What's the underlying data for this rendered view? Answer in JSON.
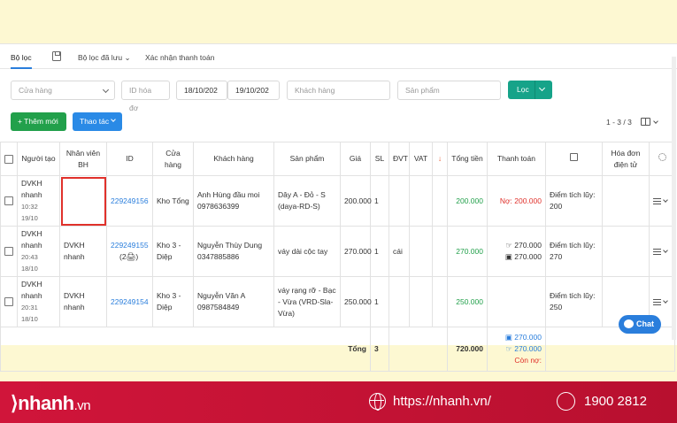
{
  "tabs": {
    "filter": "Bộ lọc",
    "saved": "Bộ lọc đã lưu",
    "confirm": "Xác nhận thanh toán"
  },
  "filters": {
    "store_placeholder": "Cửa hàng",
    "invoice_id_placeholder": "ID hóa đơ",
    "date_from": "18/10/202",
    "date_to": "19/10/202",
    "customer_placeholder": "Khách hàng",
    "product_placeholder": "Sản phẩm",
    "filter_button": "Lọc"
  },
  "toolbar": {
    "add_button": "+ Thêm mới",
    "actions_button": "Thao tác",
    "pagination": "1 - 3 / 3"
  },
  "table": {
    "headers": {
      "creator": "Người tạo",
      "sales_staff": "Nhân viên BH",
      "id": "ID",
      "store": "Cửa hàng",
      "customer": "Khách hàng",
      "product": "Sản phẩm",
      "price": "Giá",
      "qty": "SL",
      "unit": "ĐVT",
      "vat": "VAT",
      "sort_arrow": "↓",
      "total": "Tổng tiền",
      "payment": "Thanh toán",
      "invoice": "Hóa đơn điện tử"
    },
    "rows": [
      {
        "creator": "DVKH nhanh",
        "time": "10:32 19/10",
        "staff": "",
        "id": "229249156",
        "store": "Kho Tổng",
        "customer_name": "Anh Hùng đầu moi",
        "customer_phone": "0978636399",
        "product": "Dây A - Đỏ - S (daya-RD-S)",
        "price": "200.000",
        "qty": "1",
        "unit": "",
        "total": "200.000",
        "payment_1": "Nợ: 200.000",
        "payment_2": "",
        "points": "Điểm tích lũy: 200"
      },
      {
        "creator": "DVKH nhanh",
        "time": "20:43 18/10",
        "staff": "DVKH nhanh",
        "id": "229249155",
        "id_extra": "(2🖨)",
        "store": "Kho 3 - Diệp",
        "customer_name": "Nguyễn Thùy Dung",
        "customer_phone": "0347885886",
        "product": "váy dài cộc tay",
        "price": "270.000",
        "qty": "1",
        "unit": "cái",
        "total": "270.000",
        "payment_1": "270.000",
        "payment_2": "270.000",
        "points": "Điểm tích lũy: 270"
      },
      {
        "creator": "DVKH nhanh",
        "time": "20:31 18/10",
        "staff": "DVKH nhanh",
        "id": "229249154",
        "store": "Kho 3 - Diệp",
        "customer_name": "Nguyễn Văn A",
        "customer_phone": "0987584849",
        "product": "váy rạng rỡ - Bạc - Vừa (VRD-Sla-Vừa)",
        "price": "250.000",
        "qty": "1",
        "unit": "",
        "total": "250.000",
        "payment_1": "",
        "payment_2": "",
        "points": "Điểm tích lũy: 250"
      }
    ],
    "summary": {
      "label": "Tổng",
      "qty": "3",
      "total": "720.000",
      "pay_1": "270.000",
      "pay_2": "270.000",
      "debt": "Còn nợ:"
    }
  },
  "chat": {
    "label": "Chat"
  },
  "footer": {
    "logo": "nhanh",
    "logo_suffix": ".vn",
    "url": "https://nhanh.vn/",
    "phone": "1900 2812"
  },
  "colors": {
    "accent": "#2a7edc",
    "green": "#22a04b",
    "teal": "#16a389",
    "red": "#e0312b",
    "footer": "#c8133a",
    "background": "#fdf8d2"
  }
}
